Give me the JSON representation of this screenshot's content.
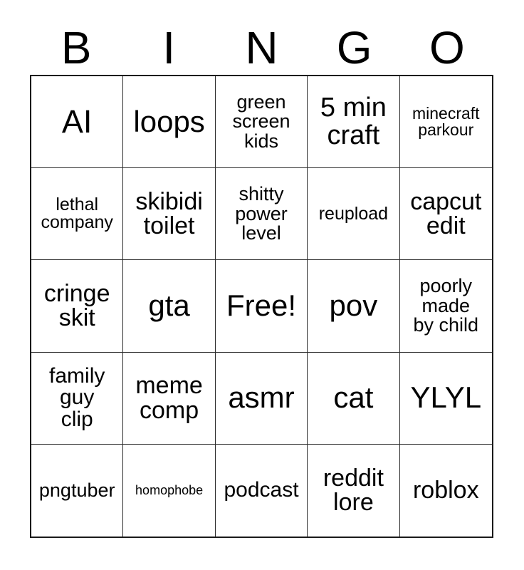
{
  "card": {
    "title": "Bingo Card",
    "header_letters": [
      "B",
      "I",
      "N",
      "G",
      "O"
    ],
    "grid_size": "5x5",
    "free_space": "Free!",
    "colors": {
      "background": "#ffffff",
      "text": "#000000",
      "grid_line": "#2b2b2b",
      "outer_border": "#1a1a1a"
    },
    "cells": [
      {
        "text": "AI",
        "size": "fs-xxl",
        "row": 1,
        "col": 1
      },
      {
        "text": "loops",
        "size": "fs-xl",
        "row": 1,
        "col": 2
      },
      {
        "text": "green\nscreen\nkids",
        "size": "fs-sm",
        "row": 1,
        "col": 3
      },
      {
        "text": "5 min\ncraft",
        "size": "fs-lg",
        "row": 1,
        "col": 4
      },
      {
        "text": "minecraft\nparkour",
        "size": "fs-xxs",
        "row": 1,
        "col": 5
      },
      {
        "text": "lethal\ncompany",
        "size": "fs-xs",
        "row": 2,
        "col": 1
      },
      {
        "text": "skibidi\ntoilet",
        "size": "fs-ml",
        "row": 2,
        "col": 2
      },
      {
        "text": "shitty\npower\nlevel",
        "size": "fs-sm",
        "row": 2,
        "col": 3
      },
      {
        "text": "reupload",
        "size": "fs-xs",
        "row": 2,
        "col": 4
      },
      {
        "text": "capcut\nedit",
        "size": "fs-ml",
        "row": 2,
        "col": 5
      },
      {
        "text": "cringe\nskit",
        "size": "fs-ml",
        "row": 3,
        "col": 1
      },
      {
        "text": "gta",
        "size": "fs-xl",
        "row": 3,
        "col": 2
      },
      {
        "text": "Free!",
        "size": "fs-xl",
        "row": 3,
        "col": 3
      },
      {
        "text": "pov",
        "size": "fs-xl",
        "row": 3,
        "col": 4
      },
      {
        "text": "poorly\nmade\nby child",
        "size": "fs-sm",
        "row": 3,
        "col": 5
      },
      {
        "text": "family\nguy\nclip",
        "size": "fs-md",
        "row": 4,
        "col": 1
      },
      {
        "text": "meme\ncomp",
        "size": "fs-ml",
        "row": 4,
        "col": 2
      },
      {
        "text": "asmr",
        "size": "fs-xl",
        "row": 4,
        "col": 3
      },
      {
        "text": "cat",
        "size": "fs-xl",
        "row": 4,
        "col": 4
      },
      {
        "text": "YLYL",
        "size": "fs-xl",
        "row": 4,
        "col": 5
      },
      {
        "text": "pngtuber",
        "size": "fs-sm",
        "row": 5,
        "col": 1
      },
      {
        "text": "homophobe",
        "size": "fs-tiny",
        "row": 5,
        "col": 2
      },
      {
        "text": "podcast",
        "size": "fs-md",
        "row": 5,
        "col": 3
      },
      {
        "text": "reddit\nlore",
        "size": "fs-ml",
        "row": 5,
        "col": 4
      },
      {
        "text": "roblox",
        "size": "fs-ml",
        "row": 5,
        "col": 5
      }
    ]
  }
}
